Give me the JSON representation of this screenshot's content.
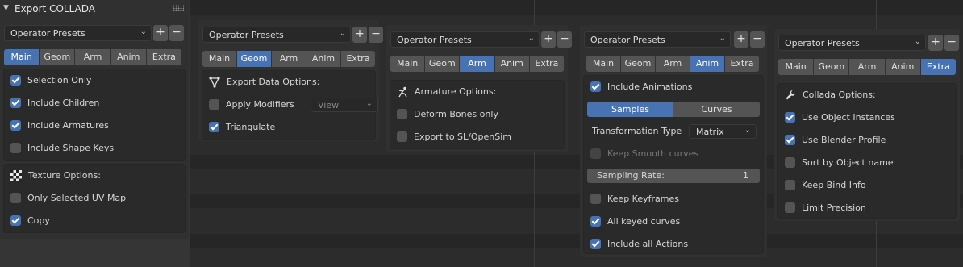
{
  "panel_title": "Export COLLADA",
  "presets": {
    "label": "Operator Presets",
    "add": "+",
    "remove": "−"
  },
  "tabs": [
    "Main",
    "Geom",
    "Arm",
    "Anim",
    "Extra"
  ],
  "main": {
    "selection_only": "Selection Only",
    "include_children": "Include Children",
    "include_armatures": "Include Armatures",
    "include_shape_keys": "Include Shape Keys",
    "texture_options": "Texture Options:",
    "only_selected_uv": "Only Selected UV Map",
    "copy": "Copy"
  },
  "geom": {
    "export_data_options": "Export Data Options:",
    "apply_modifiers": "Apply Modifiers",
    "modifiers_mode": "View",
    "triangulate": "Triangulate"
  },
  "arm": {
    "armature_options": "Armature Options:",
    "deform_bones_only": "Deform Bones only",
    "export_to_sl": "Export to SL/OpenSim"
  },
  "anim": {
    "include_animations": "Include Animations",
    "samples": "Samples",
    "curves": "Curves",
    "transformation_type": "Transformation Type",
    "transformation_value": "Matrix",
    "keep_smooth_curves": "Keep Smooth curves",
    "sampling_rate": "Sampling Rate:",
    "sampling_rate_value": "1",
    "keep_keyframes": "Keep Keyframes",
    "all_keyed_curves": "All keyed curves",
    "include_all_actions": "Include all Actions"
  },
  "extra": {
    "collada_options": "Collada Options:",
    "use_object_instances": "Use Object Instances",
    "use_blender_profile": "Use Blender Profile",
    "sort_by_object_name": "Sort by Object name",
    "keep_bind_info": "Keep Bind Info",
    "limit_precision": "Limit Precision"
  },
  "colors": {
    "accent": "#4772b3",
    "panel": "#303030",
    "box": "#2a2a2a",
    "button": "#545454"
  }
}
